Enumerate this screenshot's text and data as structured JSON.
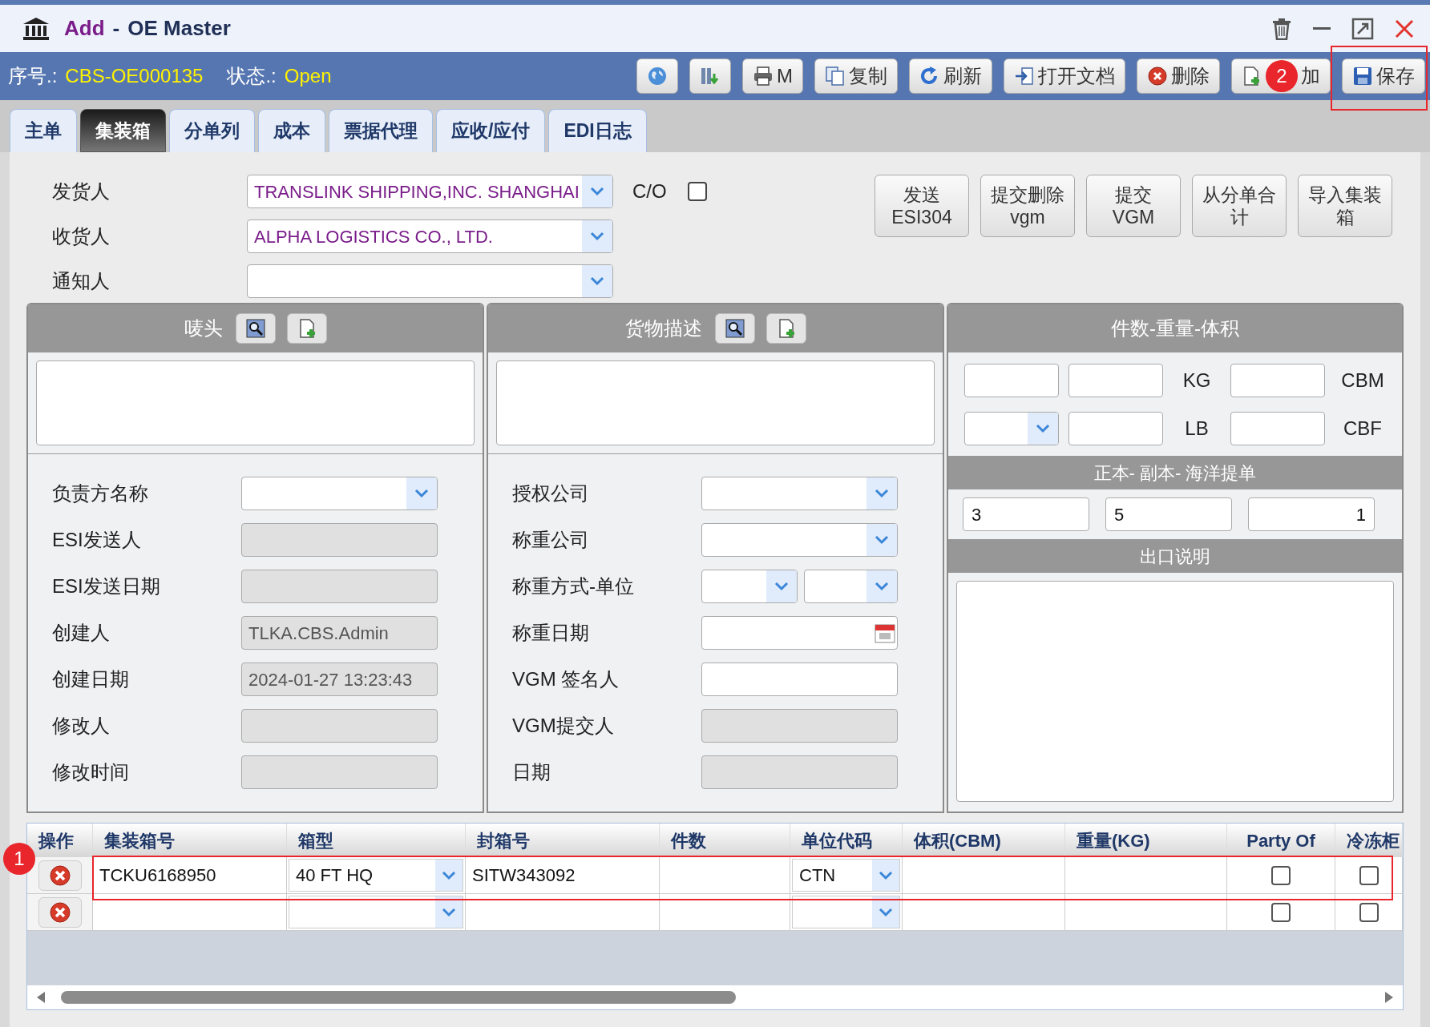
{
  "window": {
    "action": "Add",
    "separator": "-",
    "title": "OE Master"
  },
  "record": {
    "number_label": "序号.:",
    "number": "CBS-OE000135",
    "status_label": "状态.:",
    "status": "Open"
  },
  "toolbar": [
    {
      "kind": "globe"
    },
    {
      "kind": "columns"
    },
    {
      "kind": "print",
      "label": "M"
    },
    {
      "kind": "copy",
      "label": "复制"
    },
    {
      "kind": "refresh",
      "label": "刷新"
    },
    {
      "kind": "open",
      "label": "打开文档"
    },
    {
      "kind": "delete",
      "label": "删除"
    },
    {
      "kind": "new",
      "label": "加"
    },
    {
      "kind": "save",
      "label": "保存"
    }
  ],
  "tabs": [
    {
      "label": "主单",
      "selected": false
    },
    {
      "label": "集装箱",
      "selected": true
    },
    {
      "label": "分单列",
      "selected": false
    },
    {
      "label": "成本",
      "selected": false
    },
    {
      "label": "票据代理",
      "selected": false
    },
    {
      "label": "应收/应付",
      "selected": false
    },
    {
      "label": "EDI日志",
      "selected": false
    }
  ],
  "parties": [
    {
      "label": "发货人",
      "value": "TRANSLINK SHIPPING,INC. SHANGHAI"
    },
    {
      "label": "收货人",
      "value": "ALPHA LOGISTICS CO., LTD."
    },
    {
      "label": "通知人"
    }
  ],
  "co": {
    "label": "C/O",
    "checked": false
  },
  "actions": [
    {
      "lines": [
        "发送",
        "ESI304"
      ]
    },
    {
      "lines": [
        "提交删除",
        "vgm"
      ]
    },
    {
      "lines": [
        "提交",
        "VGM"
      ]
    },
    {
      "lines": [
        "从分单合",
        "计"
      ]
    },
    {
      "lines": [
        "导入集装",
        "箱"
      ]
    }
  ],
  "marks_panel": {
    "title": "唛头"
  },
  "cargo_panel": {
    "title": "货物描述"
  },
  "left_fields": [
    {
      "label": "负责方名称",
      "kind": "select"
    },
    {
      "label": "ESI发送人",
      "kind": "readonly"
    },
    {
      "label": "ESI发送日期",
      "kind": "readonly"
    },
    {
      "label": "创建人",
      "kind": "readonly",
      "value": "TLKA.CBS.Admin"
    },
    {
      "label": "创建日期",
      "kind": "readonly",
      "value": "2024-01-27 13:23:43"
    },
    {
      "label": "修改人",
      "kind": "readonly"
    },
    {
      "label": "修改时间",
      "kind": "readonly"
    }
  ],
  "middle_fields": [
    {
      "label": "授权公司",
      "kind": "select"
    },
    {
      "label": "称重公司",
      "kind": "select"
    },
    {
      "label": "称重方式-单位",
      "kind": "double_select"
    },
    {
      "label": "称重日期",
      "kind": "date"
    },
    {
      "label": "VGM 签名人",
      "kind": "text"
    },
    {
      "label": "VGM提交人",
      "kind": "readonly"
    },
    {
      "label": "日期",
      "kind": "readonly"
    }
  ],
  "measures": {
    "title": "件数-重量-体积",
    "units": [
      "KG",
      "CBM",
      "LB",
      "CBF"
    ]
  },
  "bl_copies": {
    "title": "正本- 副本- 海洋提单",
    "values": [
      "3",
      "5",
      "1"
    ]
  },
  "export_note": {
    "title": "出口说明"
  },
  "containers": {
    "columns": [
      "操作",
      "集装箱号",
      "箱型",
      "封箱号",
      "件数",
      "单位代码",
      "体积(CBM)",
      "重量(KG)",
      "Party Of",
      "冷冻柜"
    ],
    "rows": [
      {
        "container_no": "TCKU6168950",
        "type": "40 FT HQ",
        "seal": "SITW343092",
        "unit": "CTN",
        "party_of": false,
        "reefer": false
      },
      {
        "party_of": false,
        "reefer": false
      }
    ]
  },
  "annotations": [
    {
      "label": "1"
    },
    {
      "label": "2"
    }
  ]
}
